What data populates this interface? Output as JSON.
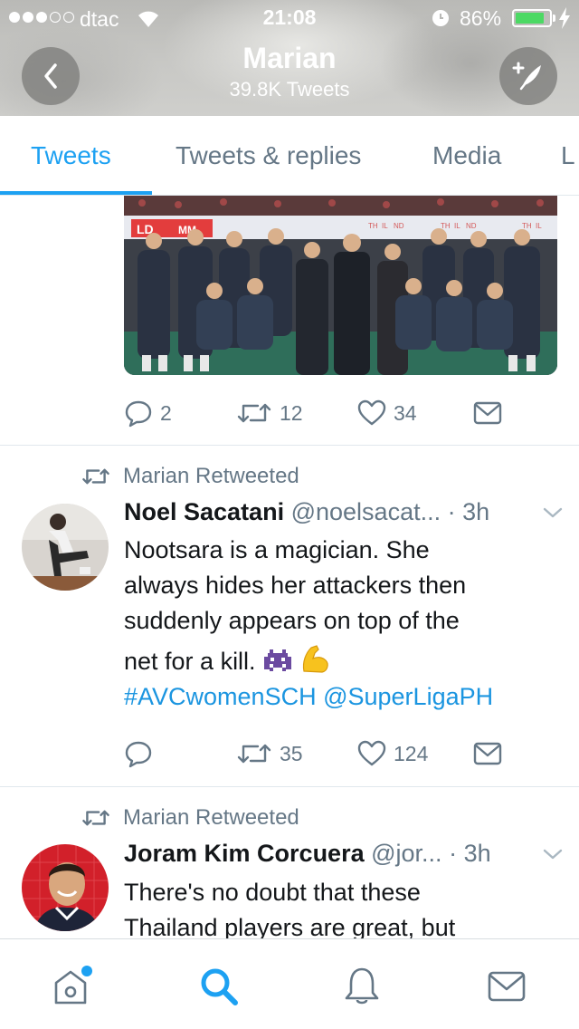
{
  "status_bar": {
    "carrier": "dtac",
    "time": "21:08",
    "battery": "86%",
    "battery_level": 0.86
  },
  "profile_header": {
    "name": "Marian",
    "tweet_count": "39.8K Tweets"
  },
  "tabs": [
    {
      "label": "Tweets",
      "active": true
    },
    {
      "label": "Tweets & replies",
      "active": false
    },
    {
      "label": "Media",
      "active": false
    },
    {
      "label": "L",
      "active": false
    }
  ],
  "tweet_1": {
    "photo_banner_texts": [
      "TH",
      "IL",
      "ND",
      "LD",
      "MM"
    ],
    "actions": {
      "replies": "2",
      "retweets": "12",
      "likes": "34"
    }
  },
  "tweet_2": {
    "retweet_label": "Marian Retweeted",
    "author_name": "Noel Sacatani",
    "author_handle": "@noelsacat...",
    "time": "· 3h",
    "text_lines": [
      "Nootsara is a magician. She",
      "always hides her attackers then",
      "suddenly appears on top of the",
      "net for a kill."
    ],
    "emojis": [
      "alien-monster-emoji",
      "flexed-biceps-emoji"
    ],
    "hashtag": "#AVCwomenSCH",
    "mention": "@SuperLigaPH",
    "actions": {
      "replies": "",
      "retweets": "35",
      "likes": "124"
    }
  },
  "tweet_3": {
    "retweet_label": "Marian Retweeted",
    "author_name": "Joram Kim Corcuera",
    "author_handle": "@jor...",
    "time": "· 3h",
    "text_lines": [
      "There's no doubt that these",
      "Thailand players are great, but"
    ]
  },
  "bottom_nav": [
    {
      "name": "home",
      "icon": "home-icon",
      "active": false,
      "notification_dot": true
    },
    {
      "name": "search",
      "icon": "search-icon",
      "active": true
    },
    {
      "name": "notifications",
      "icon": "bell-icon",
      "active": false
    },
    {
      "name": "messages",
      "icon": "mail-icon",
      "active": false
    }
  ],
  "colors": {
    "accent": "#1da1f2",
    "link": "#1b95e0",
    "secondary_text": "#657786",
    "divider": "#e1e8ed"
  }
}
